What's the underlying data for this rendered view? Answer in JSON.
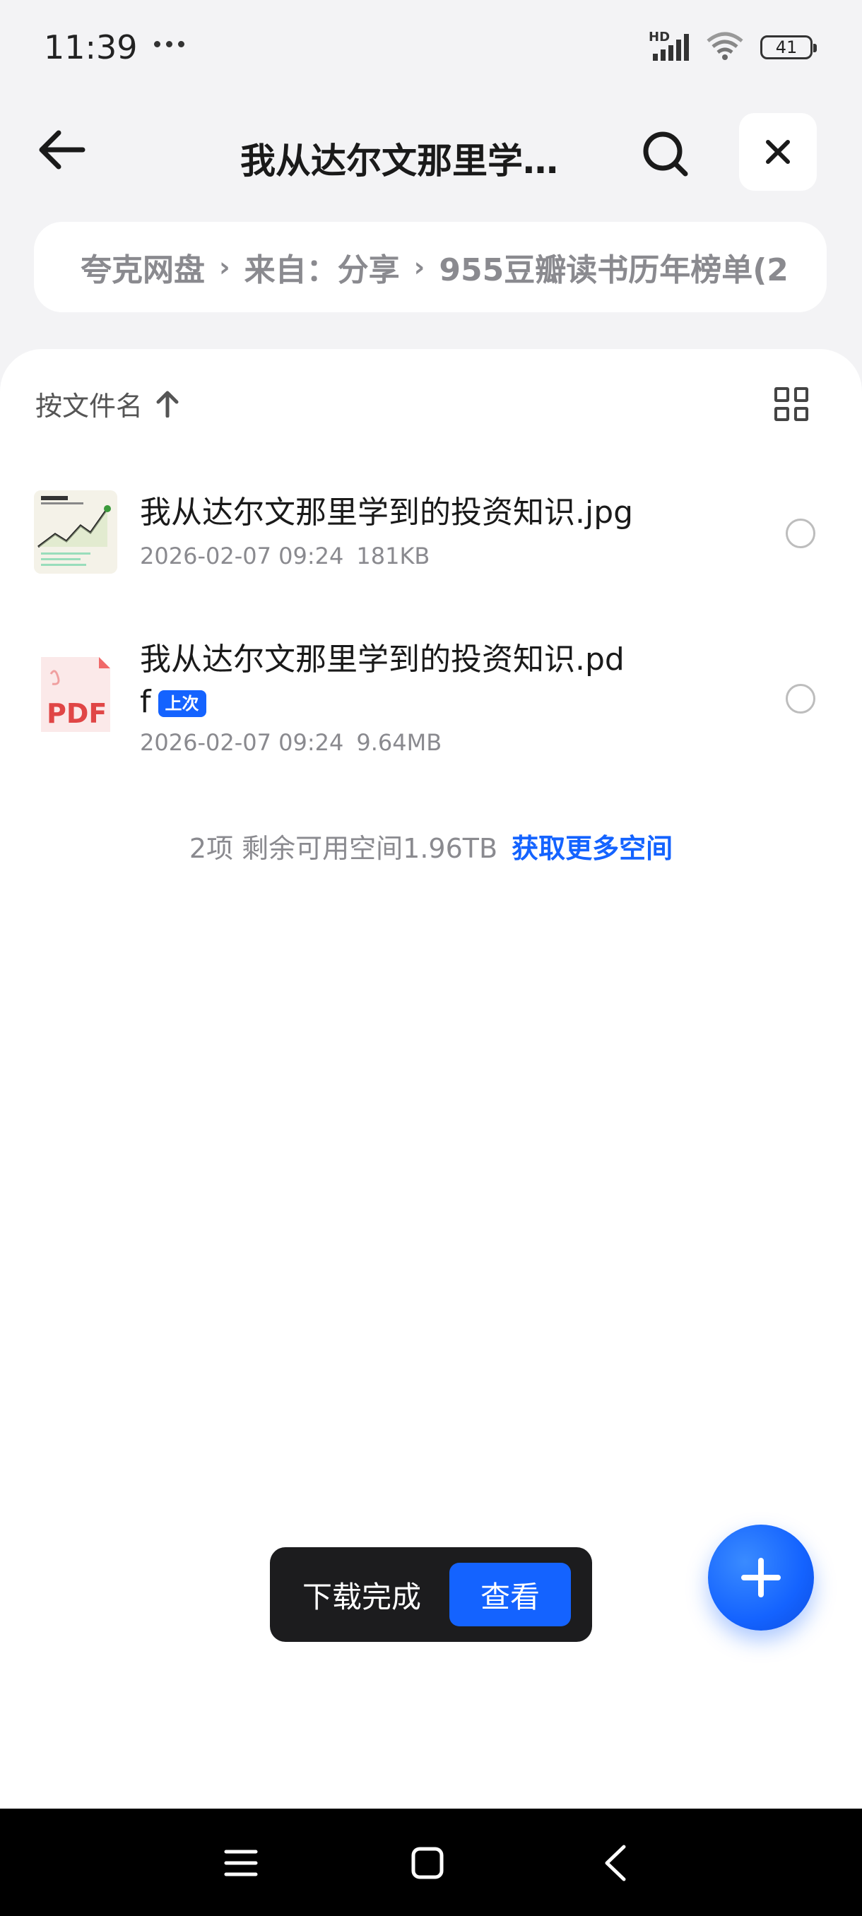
{
  "status_bar": {
    "time": "11:39",
    "network_label": "HD",
    "battery": "41"
  },
  "header": {
    "title": "我从达尔文那里学…",
    "icons": [
      "back-arrow-icon",
      "search-icon",
      "close-icon"
    ]
  },
  "breadcrumb": {
    "items": [
      "夸克网盘",
      "来自：分享",
      "955豆瓣读书历年榜单(2"
    ],
    "separator": "›"
  },
  "sort": {
    "label": "按文件名",
    "direction_icon": "arrow-up-icon",
    "view_icon": "grid-view-icon"
  },
  "files": [
    {
      "name": "我从达尔文那里学到的投资知识.jpg",
      "date": "2026-02-07 09:24",
      "size": "181KB",
      "thumb_type": "image"
    },
    {
      "name_line1": "我从达尔文那里学到的投资知识.pd",
      "name_line2": "f",
      "badge": "上次",
      "date": "2026-02-07 09:24",
      "size": "9.64MB",
      "thumb_type": "pdf",
      "thumb_label": "PDF"
    }
  ],
  "summary": {
    "text": "2项 剩余可用空间1.96TB",
    "link": "获取更多空间"
  },
  "toast": {
    "text": "下载完成",
    "button": "查看"
  },
  "colors": {
    "accent": "#1463ff",
    "background": "#f3f3f5",
    "toast_bg": "#1c1c1e"
  }
}
